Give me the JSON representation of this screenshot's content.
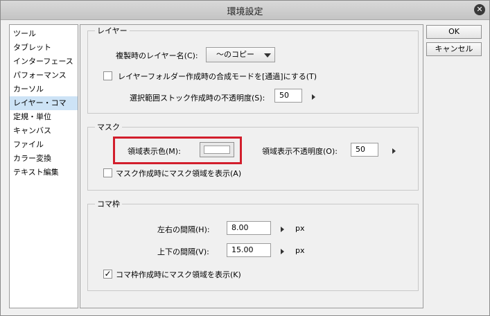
{
  "window": {
    "title": "環境設定",
    "close_icon": "close-icon"
  },
  "sidebar": {
    "items": [
      "ツール",
      "タブレット",
      "インターフェース",
      "パフォーマンス",
      "カーソル",
      "レイヤー・コマ",
      "定規・単位",
      "キャンバス",
      "ファイル",
      "カラー変換",
      "テキスト編集"
    ],
    "selected": "レイヤー・コマ"
  },
  "buttons": {
    "ok": "OK",
    "cancel": "キャンセル"
  },
  "layer": {
    "legend": "レイヤー",
    "dup_name_label": "複製時のレイヤー名(C):",
    "dup_name_value": "～のコピー",
    "folder_blend_label": "レイヤーフォルダー作成時の合成モードを[通過]にする(T)",
    "folder_blend_checked": false,
    "stock_opacity_label": "選択範囲ストック作成時の不透明度(S):",
    "stock_opacity_value": "50"
  },
  "mask": {
    "legend": "マスク",
    "area_color_label": "領域表示色(M):",
    "area_color": "#ffffff",
    "area_opacity_label": "領域表示不透明度(O):",
    "area_opacity_value": "50",
    "show_on_create_label": "マスク作成時にマスク領域を表示(A)",
    "show_on_create_checked": false
  },
  "frame": {
    "legend": "コマ枠",
    "h_gap_label": "左右の間隔(H):",
    "h_gap_value": "8.00",
    "v_gap_label": "上下の間隔(V):",
    "v_gap_value": "15.00",
    "unit": "px",
    "show_mask_label": "コマ枠作成時にマスク領域を表示(K)",
    "show_mask_checked": true,
    "check_mark": "✓"
  },
  "highlight_color": "#d21e2c"
}
